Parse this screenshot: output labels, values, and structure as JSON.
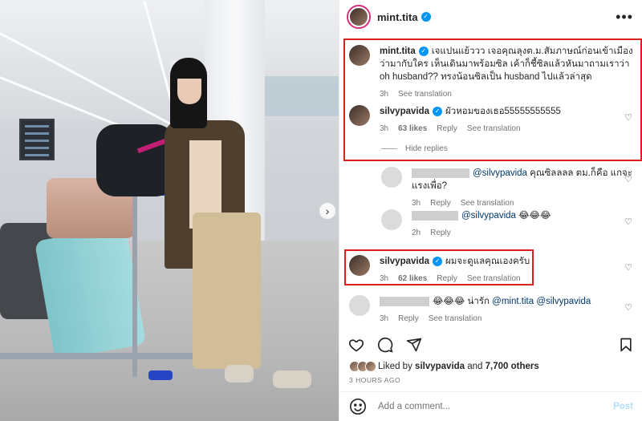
{
  "header": {
    "username": "mint.tita",
    "verified": true,
    "more_icon": "more-horizontal-icon"
  },
  "comments": [
    {
      "username": "mint.tita",
      "verified": true,
      "text": "เจแปนแย้ววว เจอคุณลุงต.ม.สัมภาษณ์ก่อนเข้าเมือง ว่ามากับใคร เห็นเดินมาพร้อมซิล เค้าก็ชี้ซิลแล้วหันมาถามเราว่า oh husband?? ทรงน้อนซิลเป็น husband ไปแล้วล่าสุด",
      "time": "3h",
      "actions": [
        "See translation"
      ]
    },
    {
      "username": "silvypavida",
      "verified": true,
      "text": "ผัวหอมของเธอ55555555555",
      "time": "3h",
      "likes": "63 likes",
      "actions": [
        "Reply",
        "See translation"
      ]
    },
    {
      "hide_replies": "Hide replies"
    },
    {
      "mention": "@silvypavida",
      "text": "คุณซิลลลล ตม.ก็คือ แกจะแรงเพื่อ?",
      "time": "3h",
      "actions": [
        "Reply",
        "See translation"
      ]
    },
    {
      "mention": "@silvypavida",
      "text": "😂😂😂",
      "time": "2h",
      "actions": [
        "Reply"
      ]
    },
    {
      "username": "silvypavida",
      "verified": true,
      "text": "ผมจะดูแลคุณเองครับ",
      "time": "3h",
      "likes": "62 likes",
      "actions": [
        "Reply",
        "See translation"
      ]
    },
    {
      "text": "😂😂😂 น่ารัก",
      "mentions": [
        "@mint.tita",
        "@silvypavida"
      ],
      "time": "3h",
      "actions": [
        "Reply",
        "See translation"
      ]
    }
  ],
  "action_bar": {
    "icons": [
      "heart-icon",
      "comment-icon",
      "share-icon",
      "bookmark-icon"
    ]
  },
  "likes": {
    "prefix": "Liked by",
    "user": "silvypavida",
    "middle": "and",
    "others": "7,700 others"
  },
  "timestamp": "3 HOURS AGO",
  "add_comment": {
    "placeholder": "Add a comment...",
    "post_label": "Post",
    "emoji_icon": "smiley-icon"
  },
  "colors": {
    "highlight_box": "#d9211e",
    "link": "#00376b",
    "verified": "#0095f6",
    "muted": "#737373"
  }
}
